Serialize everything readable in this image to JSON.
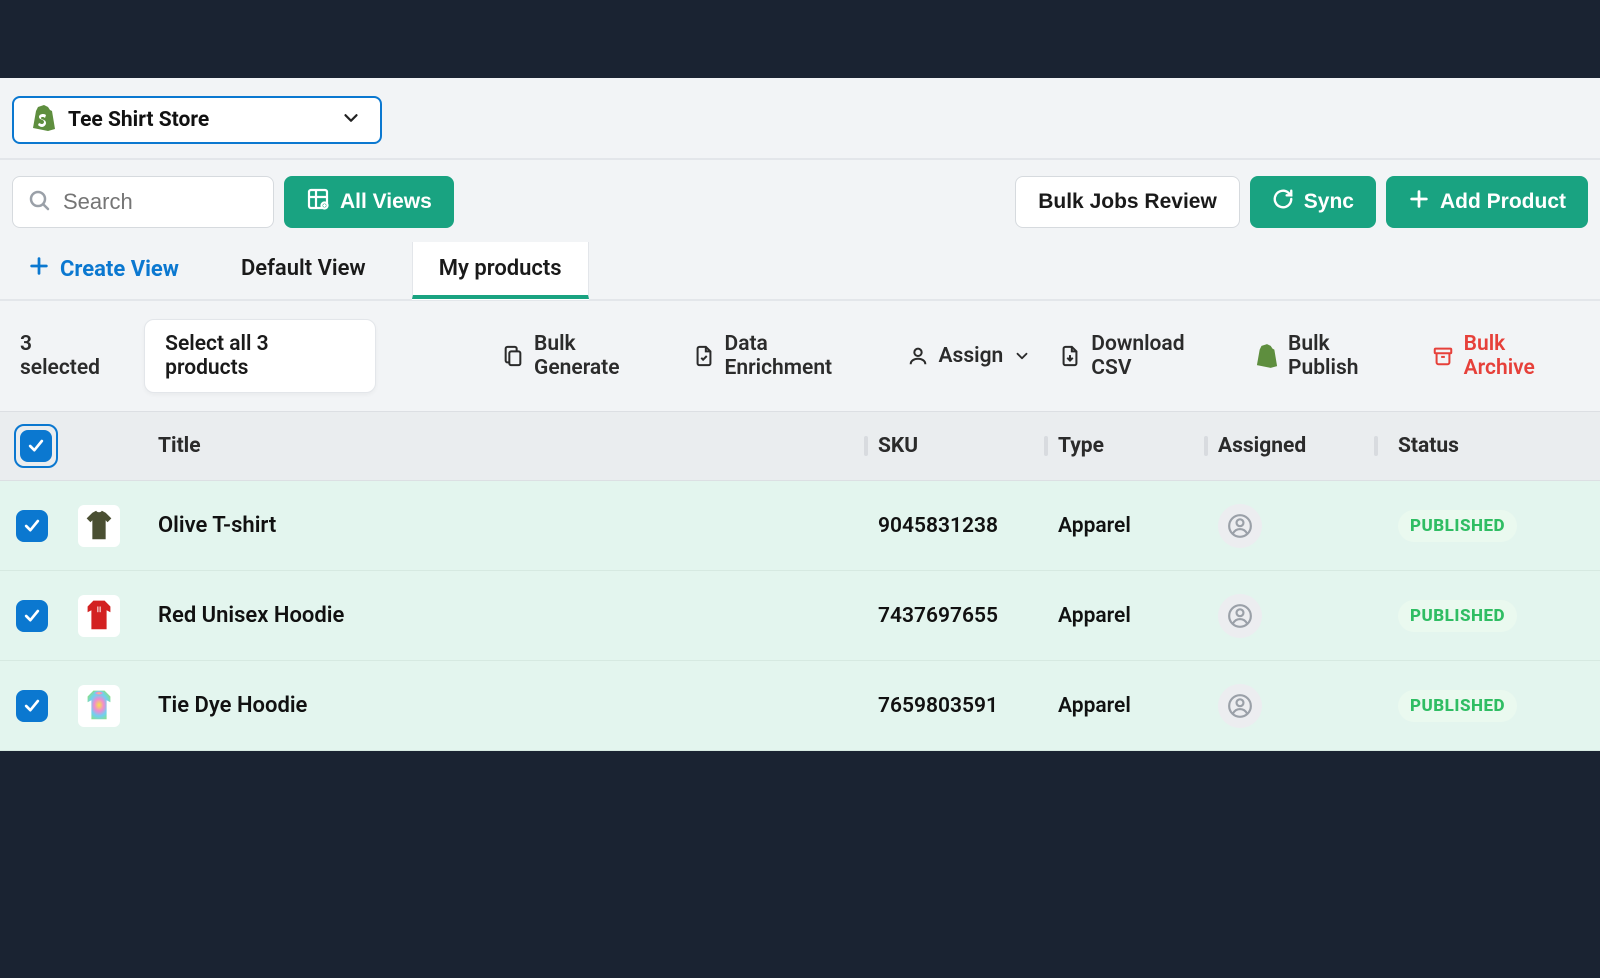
{
  "store": {
    "name": "Tee Shirt Store"
  },
  "search": {
    "placeholder": "Search"
  },
  "toolbar": {
    "all_views": "All Views",
    "bulk_jobs": "Bulk Jobs Review",
    "sync": "Sync",
    "add_product": "Add Product"
  },
  "tabs": {
    "create_view": "Create View",
    "default_view": "Default View",
    "my_products": "My products"
  },
  "selection": {
    "count_text": "3 selected",
    "select_all": "Select all 3 products"
  },
  "actions": {
    "bulk_generate": "Bulk Generate",
    "data_enrichment": "Data Enrichment",
    "assign": "Assign",
    "download_csv": "Download CSV",
    "bulk_publish": "Bulk Publish",
    "bulk_archive": "Bulk Archive"
  },
  "columns": {
    "title": "Title",
    "sku": "SKU",
    "type": "Type",
    "assigned": "Assigned",
    "status": "Status"
  },
  "rows": [
    {
      "title": "Olive T-shirt",
      "sku": "9045831238",
      "type": "Apparel",
      "status": "PUBLISHED",
      "thumb_color": "#4a4f32",
      "thumb_kind": "tshirt"
    },
    {
      "title": "Red Unisex Hoodie",
      "sku": "7437697655",
      "type": "Apparel",
      "status": "PUBLISHED",
      "thumb_color": "#d32121",
      "thumb_kind": "hoodie"
    },
    {
      "title": "Tie Dye Hoodie",
      "sku": "7659803591",
      "type": "Apparel",
      "status": "PUBLISHED",
      "thumb_color": "tiedye",
      "thumb_kind": "hoodie"
    }
  ],
  "colors": {
    "accent_green": "#19a381",
    "accent_blue": "#0b78d0",
    "danger": "#e6403a"
  }
}
